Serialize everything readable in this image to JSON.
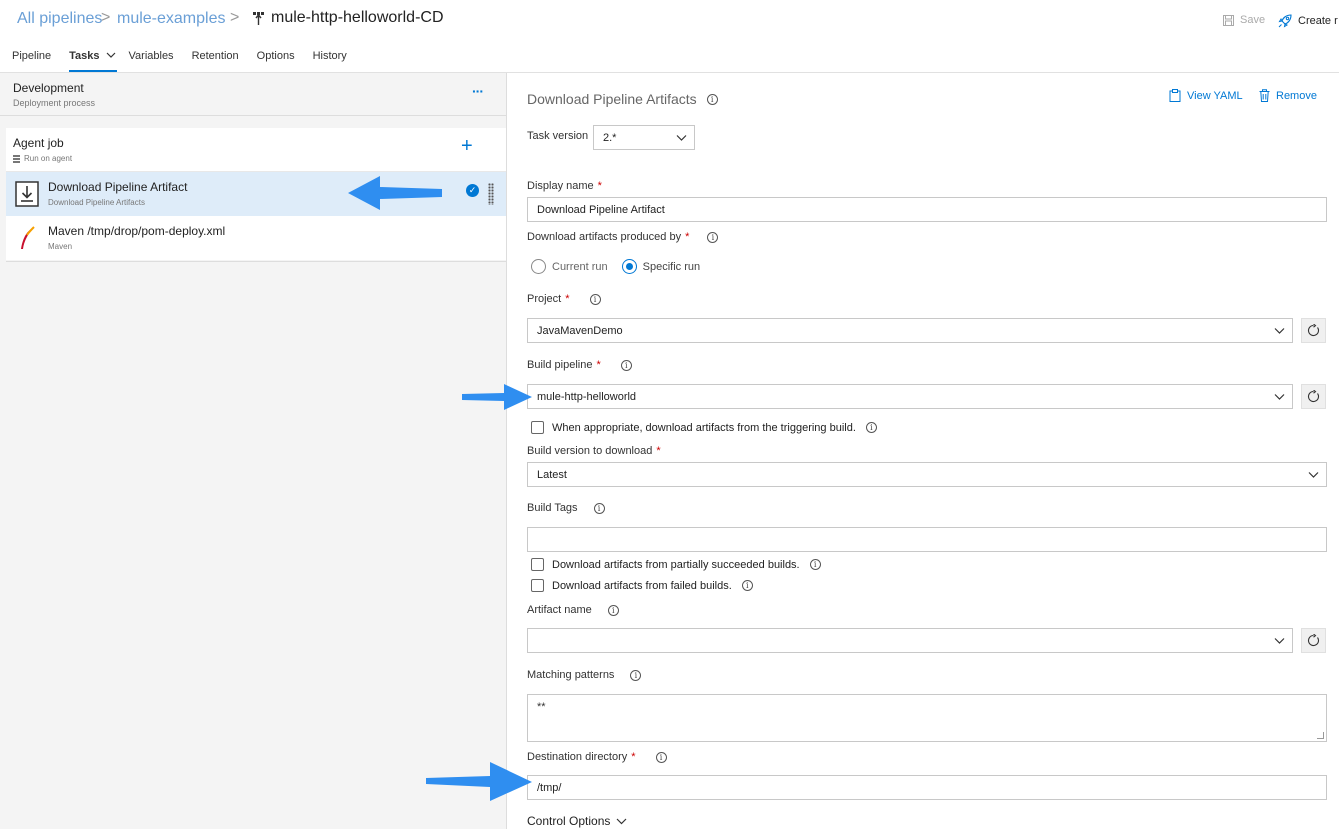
{
  "breadcrumb": {
    "all_pipelines": "All pipelines",
    "project": "mule-examples",
    "separator": ">"
  },
  "pipeline_title": "mule-http-helloworld-CD",
  "header_actions": {
    "save": "Save",
    "create": "Create r"
  },
  "tabs": [
    {
      "label": "Pipeline"
    },
    {
      "label": "Tasks"
    },
    {
      "label": "Variables"
    },
    {
      "label": "Retention"
    },
    {
      "label": "Options"
    },
    {
      "label": "History"
    }
  ],
  "stage": {
    "title": "Development",
    "subtitle": "Deployment process"
  },
  "agent_job": {
    "title": "Agent job",
    "subtitle": "Run on agent"
  },
  "tasks": [
    {
      "title": "Download Pipeline Artifact",
      "subtitle": "Download Pipeline Artifacts",
      "icon": "download-icon",
      "selected": true
    },
    {
      "title": "Maven /tmp/drop/pom-deploy.xml",
      "subtitle": "Maven",
      "icon": "maven-feather-icon",
      "selected": false
    }
  ],
  "panel": {
    "title": "Download Pipeline Artifacts",
    "view_yaml": "View YAML",
    "remove": "Remove",
    "task_version_label": "Task version",
    "task_version_value": "2.*",
    "display_name_label": "Display name",
    "display_name_value": "Download Pipeline Artifact",
    "produced_by_label": "Download artifacts produced by",
    "radio_current": "Current run",
    "radio_specific": "Specific run",
    "project_label": "Project",
    "project_value": "JavaMavenDemo",
    "build_pipeline_label": "Build pipeline",
    "build_pipeline_value": "mule-http-helloworld",
    "triggering_label": "When appropriate, download artifacts from the triggering build.",
    "build_version_label": "Build version to download",
    "build_version_value": "Latest",
    "build_tags_label": "Build Tags",
    "build_tags_value": "",
    "partial_label": "Download artifacts from partially succeeded builds.",
    "failed_label": "Download artifacts from failed builds.",
    "artifact_name_label": "Artifact name",
    "artifact_name_value": "",
    "matching_label": "Matching patterns",
    "matching_value": "**",
    "destination_label": "Destination directory",
    "destination_value": "/tmp/",
    "control_options": "Control Options",
    "required_mark": "*"
  },
  "colors": {
    "accent": "#0078d4",
    "selected_row": "#deecf9",
    "annotation_arrow": "#2f8ef0",
    "required": "#cc0000"
  }
}
